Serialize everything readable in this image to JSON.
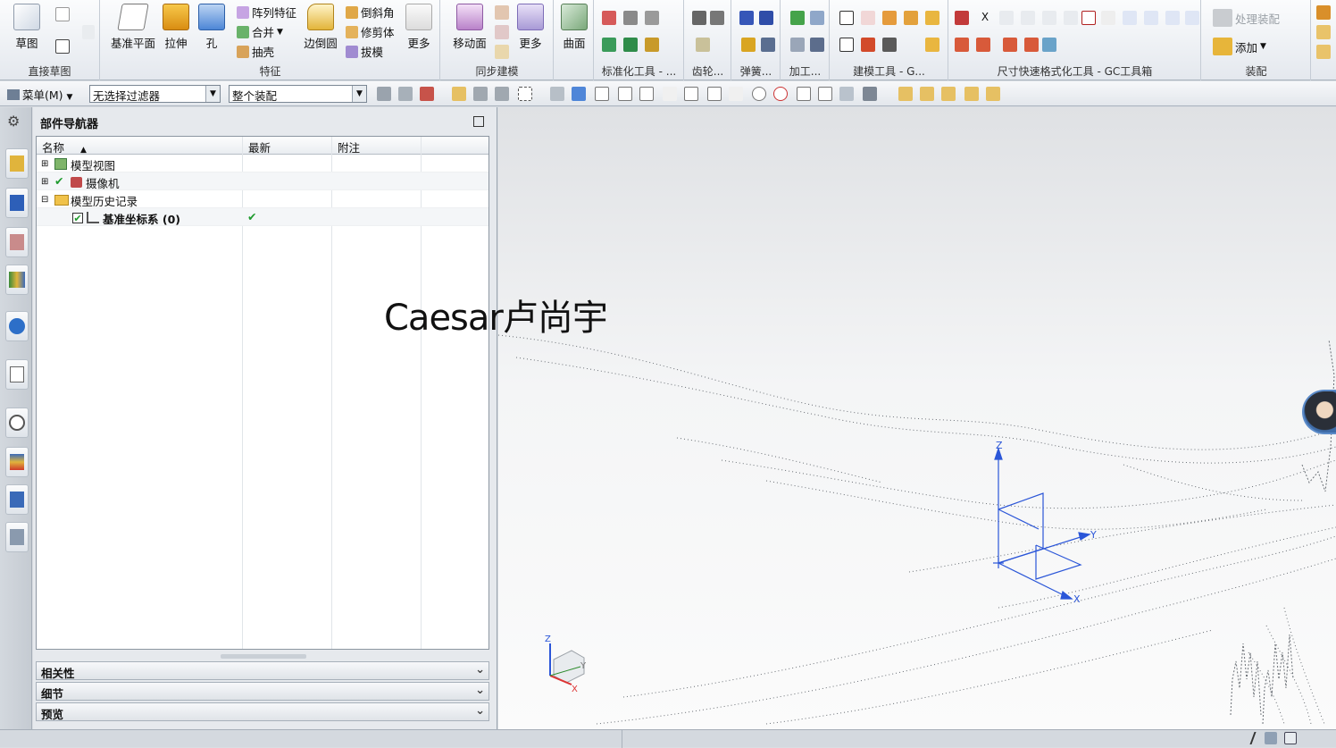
{
  "ribbon": {
    "groups": [
      {
        "label": "直接草图"
      },
      {
        "label": "特征"
      },
      {
        "label": "同步建模"
      },
      {
        "label": "标准化工具 - ..."
      },
      {
        "label": "齿轮..."
      },
      {
        "label": "弹簧..."
      },
      {
        "label": "加工..."
      },
      {
        "label": "建模工具 - G..."
      },
      {
        "label": "尺寸快速格式化工具 - GC工具箱"
      },
      {
        "label": "装配"
      }
    ],
    "buttons": {
      "sketch": "草图",
      "datum_plane": "基准平面",
      "extrude": "拉伸",
      "hole": "孔",
      "pattern_feature": "阵列特征",
      "unite": "合并",
      "shell": "抽壳",
      "edge_blend": "边倒圆",
      "chamfer": "倒斜角",
      "trim_body": "修剪体",
      "draft": "拔模",
      "more_feature": "更多",
      "move_face": "移动面",
      "more_sync": "更多",
      "surface": "曲面",
      "process_assembly": "处理装配",
      "add": "添加"
    }
  },
  "toolbar": {
    "menu_label": "菜单(M)",
    "filter_value": "无选择过滤器",
    "assembly_scope": "整个装配"
  },
  "navigator": {
    "title": "部件导航器",
    "columns": [
      "名称",
      "最新",
      "附注"
    ],
    "rows": [
      {
        "name": "模型视图",
        "latest": ""
      },
      {
        "name": "摄像机",
        "latest": ""
      },
      {
        "name": "模型历史记录",
        "latest": ""
      },
      {
        "name": "基准坐标系 (0)",
        "latest": "✔"
      }
    ],
    "panels": [
      "相关性",
      "细节",
      "预览"
    ]
  },
  "graphics": {
    "watermark": "Caesar卢尚宇",
    "csys_axes": [
      "Z",
      "Y",
      "X"
    ],
    "triad_axes": [
      "Z",
      "Y",
      "X"
    ]
  },
  "colors": {
    "accent": "#2b56d8",
    "check": "#1f9b2e"
  }
}
